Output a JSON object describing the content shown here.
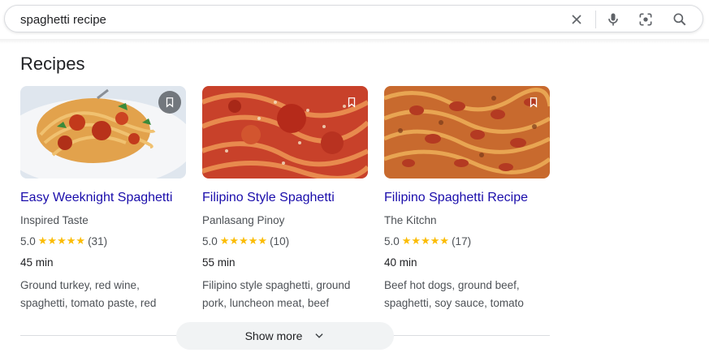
{
  "search": {
    "query": "spaghetti recipe"
  },
  "icons": {
    "clear": "close-icon",
    "voice": "microphone-icon",
    "lens": "camera-lens-icon",
    "search": "search-icon",
    "save": "bookmark-icon",
    "expand": "chevron-down-icon"
  },
  "colors": {
    "link": "#1a0dab",
    "star": "#fbbc04",
    "muted_text": "#4d5156"
  },
  "section": {
    "title": "Recipes"
  },
  "recipes": [
    {
      "title": "Easy Weeknight Spaghetti",
      "source": "Inspired Taste",
      "rating": "5.0",
      "stars": "★★★★★",
      "reviews": "(31)",
      "time": "45 min",
      "ingredients_line1": "Ground turkey, red wine,",
      "ingredients_line2": "spaghetti, tomato paste, red"
    },
    {
      "title": "Filipino Style Spaghetti",
      "source": "Panlasang Pinoy",
      "rating": "5.0",
      "stars": "★★★★★",
      "reviews": "(10)",
      "time": "55 min",
      "ingredients_line1": "Filipino style spaghetti, ground",
      "ingredients_line2": "pork, luncheon meat, beef"
    },
    {
      "title": "Filipino Spaghetti Recipe",
      "source": "The Kitchn",
      "rating": "5.0",
      "stars": "★★★★★",
      "reviews": "(17)",
      "time": "40 min",
      "ingredients_line1": "Beef hot dogs, ground beef,",
      "ingredients_line2": "spaghetti, soy sauce, tomato"
    }
  ],
  "show_more": {
    "label": "Show more"
  }
}
